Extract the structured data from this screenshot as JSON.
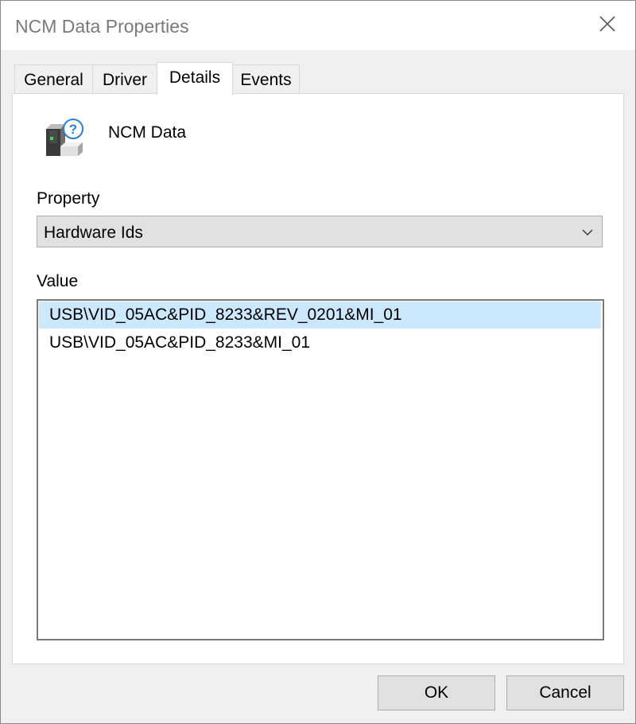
{
  "window": {
    "title": "NCM Data Properties"
  },
  "tabs": [
    {
      "label": "General"
    },
    {
      "label": "Driver"
    },
    {
      "label": "Details"
    },
    {
      "label": "Events"
    }
  ],
  "active_tab": "Details",
  "device": {
    "name": "NCM Data",
    "icon": "unknown-device-icon"
  },
  "property": {
    "label": "Property",
    "selected": "Hardware Ids"
  },
  "value": {
    "label": "Value",
    "items": [
      "USB\\VID_05AC&PID_8233&REV_0201&MI_01",
      "USB\\VID_05AC&PID_8233&MI_01"
    ],
    "selected_index": 0
  },
  "buttons": {
    "ok": "OK",
    "cancel": "Cancel"
  },
  "colors": {
    "selection": "#cce8ff",
    "help_icon": "#2b7fd8"
  }
}
